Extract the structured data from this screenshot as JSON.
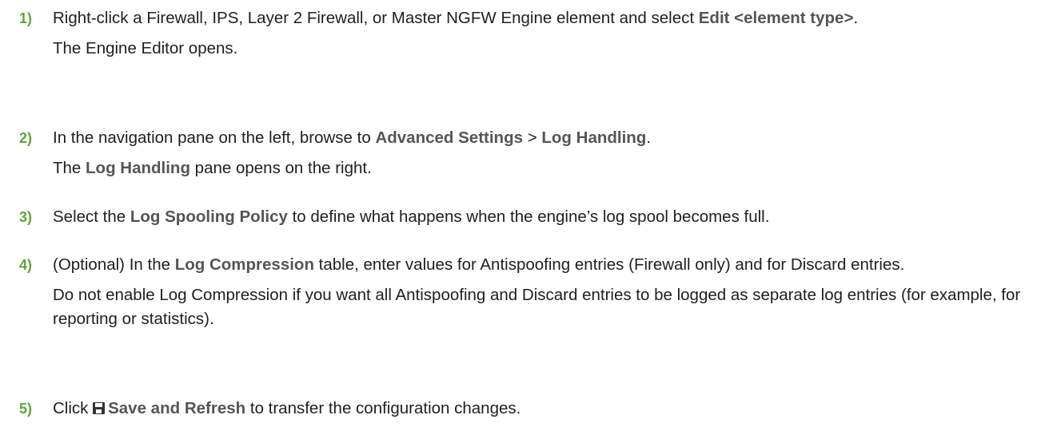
{
  "colors": {
    "step_number": "#5ea63a",
    "ui_term": "#555555",
    "body_text": "#1f1f1f"
  },
  "steps": [
    {
      "number": "1)",
      "text_a": "Right-click a Firewall, IPS, Layer 2 Firewall, or Master NGFW Engine element and select ",
      "ui_term": "Edit <element type>",
      "text_b": ".",
      "result": "The Engine Editor opens."
    },
    {
      "number": "2)",
      "text_a": "In the navigation pane on the left, browse to ",
      "ui_term_1": "Advanced Settings",
      "separator": " > ",
      "ui_term_2": "Log Handling",
      "text_b": ".",
      "result_a": "The ",
      "result_ui": "Log Handling",
      "result_b": " pane opens on the right."
    },
    {
      "number": "3)",
      "text_a": "Select the ",
      "ui_term": "Log Spooling Policy",
      "text_b": " to define what happens when the engine’s log spool becomes full."
    },
    {
      "number": "4)",
      "text_a": "(Optional) In the ",
      "ui_term": "Log Compression",
      "text_b": " table, enter values for Antispoofing entries (Firewall only) and for Discard entries.",
      "note": "Do not enable Log Compression if you want all Antispoofing and Discard entries to be logged as separate log entries (for example, for reporting or statistics)."
    },
    {
      "number": "5)",
      "text_a": "Click ",
      "icon": "save-icon",
      "ui_term": "Save and Refresh",
      "text_b": " to transfer the configuration changes."
    }
  ]
}
